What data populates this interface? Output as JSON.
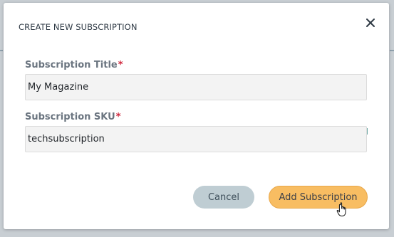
{
  "dialog": {
    "title": "CREATE NEW SUBSCRIPTION",
    "close_icon": "close-icon"
  },
  "form": {
    "title_field": {
      "label": "Subscription Title",
      "required_mark": "*",
      "value": "My Magazine"
    },
    "sku_field": {
      "label": "Subscription SKU",
      "required_mark": "*",
      "value": "techsubscription"
    }
  },
  "actions": {
    "cancel_label": "Cancel",
    "submit_label": "Add Subscription"
  },
  "colors": {
    "submit_button": "#f8bd62",
    "cancel_button": "#bfcdd3",
    "required_mark": "#d0253b"
  },
  "pointer": "hand-cursor-icon"
}
